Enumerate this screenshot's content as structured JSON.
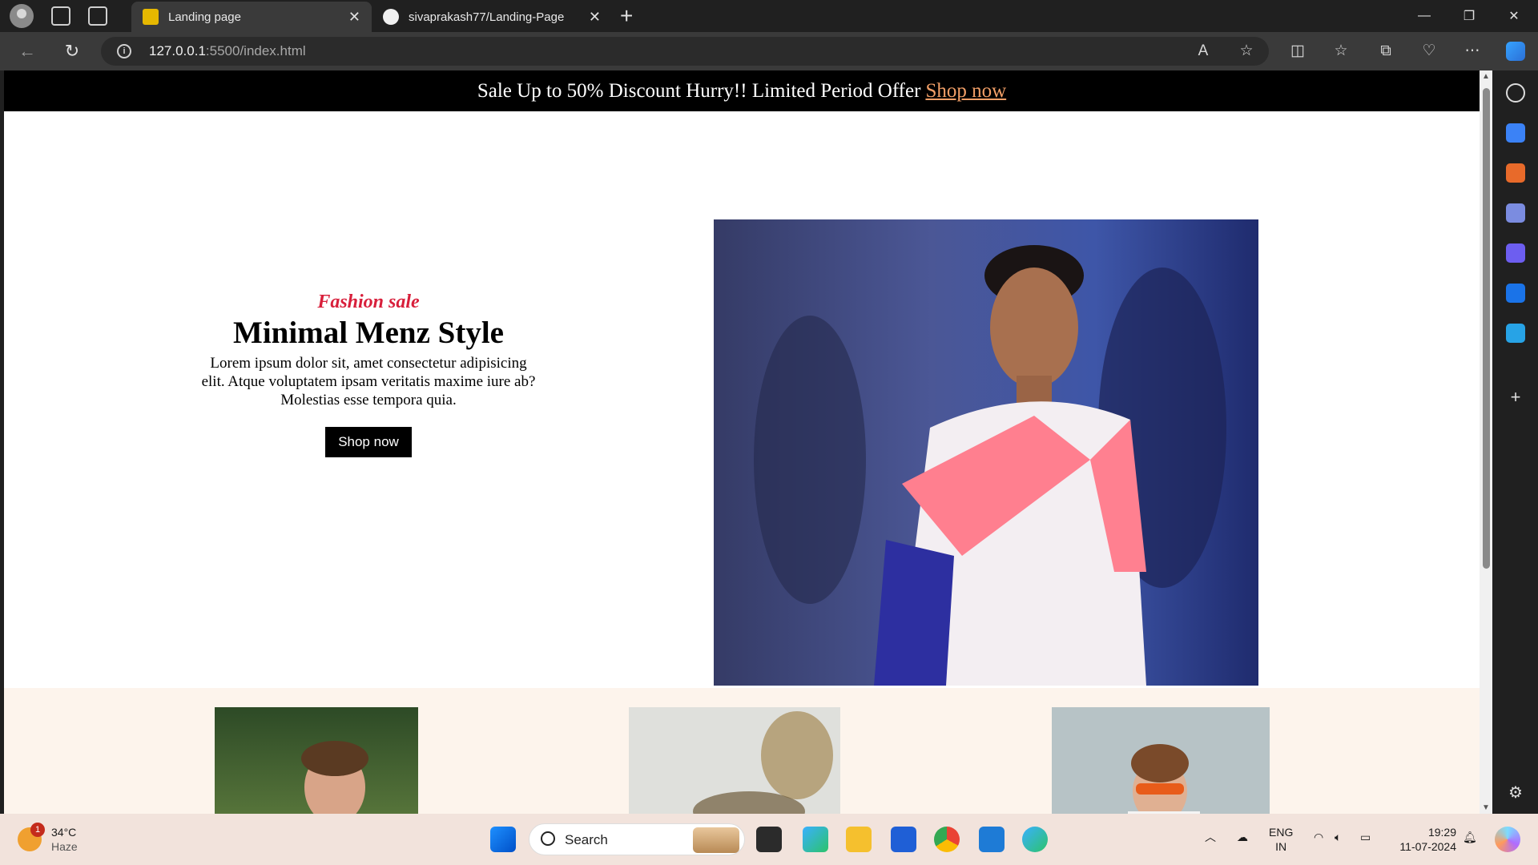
{
  "browser": {
    "tabs": [
      {
        "title": "Landing page",
        "active": true
      },
      {
        "title": "sivaprakash77/Landing-Page",
        "active": false
      }
    ],
    "address": {
      "host": "127.0.0.1",
      "path": ":5500/index.html"
    }
  },
  "page": {
    "promo": {
      "text": "Sale Up to 50% Discount Hurry!! Limited Period Offer",
      "link": "Shop now"
    },
    "hero": {
      "subtitle": "Fashion sale",
      "title": "Minimal Menz Style",
      "description": "Lorem ipsum dolor sit, amet consectetur adipisicing elit. Atque voluptatem ipsam veritatis maxime iure ab? Molestias esse tempora quia.",
      "button": "Shop now"
    }
  },
  "taskbar": {
    "weather": {
      "temp": "34°C",
      "condition": "Haze",
      "badge": "1"
    },
    "search_label": "Search",
    "lang": {
      "line1": "ENG",
      "line2": "IN"
    },
    "clock": {
      "time": "19:29",
      "date": "11-07-2024"
    }
  },
  "colors": {
    "promo_bg": "#000000",
    "promo_link": "#f29f67",
    "subtitle": "#d81f3b",
    "products_bg": "#fdf4ec"
  }
}
